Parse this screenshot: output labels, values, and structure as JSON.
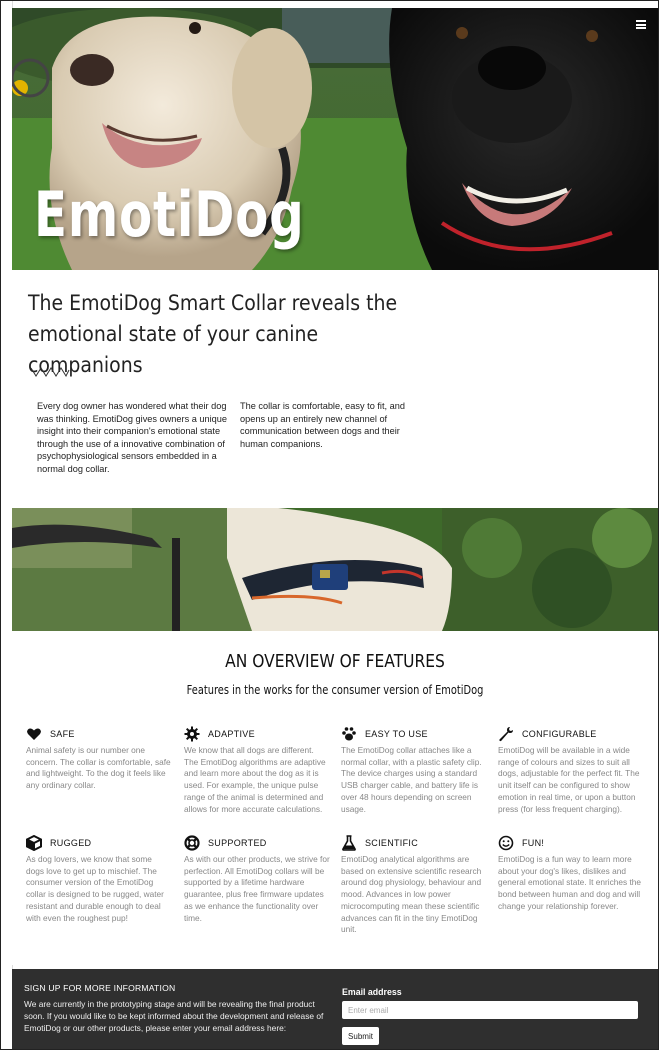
{
  "hero": {
    "title": "EmotiDog"
  },
  "nav": {
    "menu_icon": "hamburger-menu-icon"
  },
  "intro": {
    "headline": "The EmotiDog Smart Collar reveals the emotional state of your canine companions",
    "para1": "Every dog owner has wondered what their dog was thinking. EmotiDog gives owners a unique insight into their companion's emotional state through the use of a innovative combination of psychophysiological sensors embedded in a normal dog collar.",
    "para2": "The collar is comfortable, easy to fit, and opens up an entirely new channel of communication between dogs and their human companions."
  },
  "features": {
    "title": "AN OVERVIEW OF FEATURES",
    "subtitle": "Features in the works for the consumer version of EmotiDog",
    "items": [
      {
        "icon": "heart-icon",
        "title": "SAFE",
        "body": "Animal safety is our number one concern. The collar is comfortable, safe and lightweight. To the dog it feels like any ordinary collar."
      },
      {
        "icon": "gear-icon",
        "title": "ADAPTIVE",
        "body": "We know that all dogs are different. The EmotiDog algorithms are adaptive and learn more about the dog as it is used. For example, the unique pulse range of the animal is determined and allows for more accurate calculations."
      },
      {
        "icon": "paw-icon",
        "title": "EASY TO USE",
        "body": "The EmotiDog collar attaches like a normal collar, with a plastic safety clip. The device charges using a standard USB charger cable, and battery life is over 48 hours depending on screen usage."
      },
      {
        "icon": "wrench-icon",
        "title": "CONFIGURABLE",
        "body": "EmotiDog will be available in a wide range of colours and sizes to suit all dogs, adjustable for the perfect fit. The unit itself can be configured to show emotion in real time, or upon a button press (for less frequent charging)."
      },
      {
        "icon": "cube-icon",
        "title": "RUGGED",
        "body": "As dog lovers, we know that some dogs love to get up to mischief. The consumer version of the EmotiDog collar is designed to be rugged, water resistant and durable enough to deal with even the roughest pup!"
      },
      {
        "icon": "lifebuoy-icon",
        "title": "SUPPORTED",
        "body": "As with our other products, we strive for perfection. All EmotiDog collars will be supported by a lifetime hardware guarantee, plus free firmware updates as we enhance the functionality over time."
      },
      {
        "icon": "flask-icon",
        "title": "SCIENTIFIC",
        "body": "EmotiDog analytical algorithms are based on extensive scientific research around dog physiology, behaviour and mood. Advances in low power microcomputing mean these scientific advances can fit in the tiny EmotiDog unit."
      },
      {
        "icon": "smiley-icon",
        "title": "FUN!",
        "body": "EmotiDog is a fun way to learn more about your dog's likes, dislikes and general emotional state. It enriches the bond between human and dog and will change your relationship forever."
      }
    ]
  },
  "signup": {
    "title": "SIGN UP FOR MORE INFORMATION",
    "text": "We are currently in the prototyping stage and will be revealing the final product soon. If you would like to be kept informed about the development and release of EmotiDog or our other products, please enter your email address here:",
    "email_label": "Email address",
    "email_placeholder": "Enter email",
    "email_value": "",
    "submit_label": "Submit"
  }
}
